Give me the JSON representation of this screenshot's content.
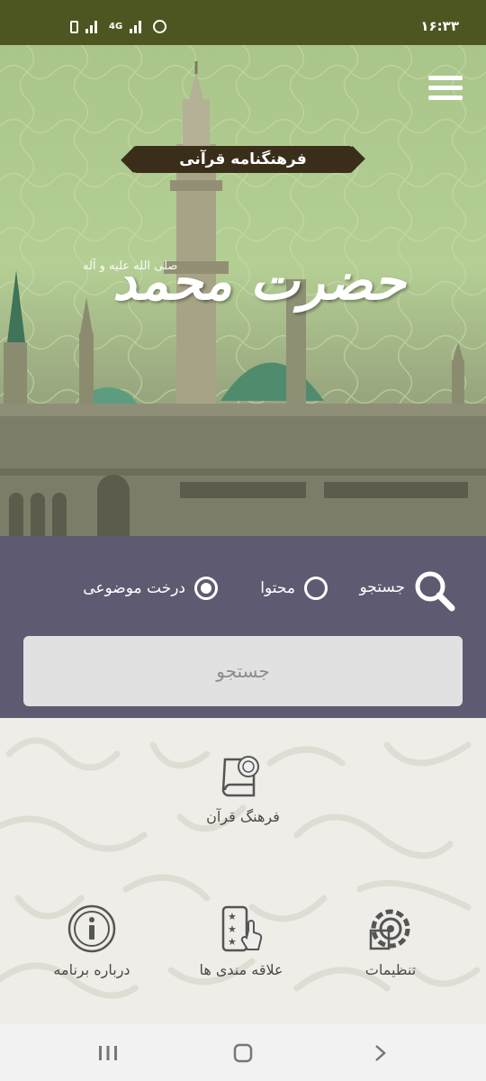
{
  "status_bar": {
    "time": "۱۶:۳۳",
    "network": "4G",
    "icons": [
      "battery-icon",
      "signal-icon",
      "data-arrows-icon",
      "signal-icon",
      "alarm-icon"
    ]
  },
  "header": {
    "menu_icon": "hamburger-icon",
    "title": "فرهنگنامه قرآنی",
    "calligraphy": "حضرت محمد",
    "salawat": "صلی الله علیه و آله"
  },
  "search": {
    "icon": "search-icon",
    "options": [
      {
        "label": "جستجو",
        "selected": false
      },
      {
        "label": "محتوا",
        "selected": false
      },
      {
        "label": "درخت موضوعی",
        "selected": true
      }
    ],
    "placeholder": "جستجو",
    "value": ""
  },
  "menu": {
    "items": [
      {
        "label": "فرهنگ قرآن",
        "icon": "quran-book-icon"
      },
      {
        "label": "تنظیمات",
        "icon": "settings-gear-icon"
      },
      {
        "label": "علاقه مندی ها",
        "icon": "favorites-icon"
      },
      {
        "label": "درباره برنامه",
        "icon": "info-icon"
      }
    ]
  },
  "navigation": {
    "buttons": [
      "recent-apps-icon",
      "home-icon",
      "back-icon"
    ]
  },
  "colors": {
    "status_bar": "#4d5620",
    "search_panel": "#5d5a71",
    "title_ribbon": "#3a2e1b",
    "menu_background": "#efede8"
  }
}
